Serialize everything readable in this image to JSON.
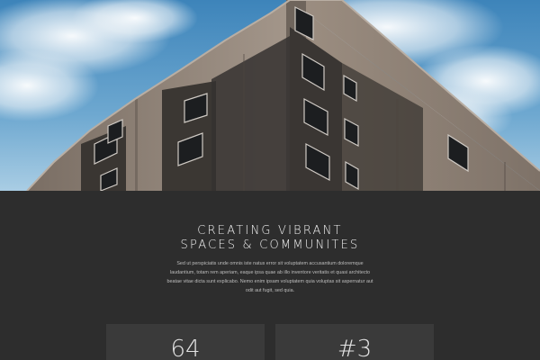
{
  "hero": {
    "image_subject": "building-corner-photo",
    "sky_color": "#5b9bc9",
    "facade_color": "#8d7f73"
  },
  "section": {
    "heading_line1": "CREATING VIBRANT",
    "heading_line2": "SPACES & COMMUNITES",
    "paragraph": "Sed ut perspiciatis unde omnis iste natus error sit voluptatem accusantium doloremque laudantium, totam rem aperiam, eaque ipsa quae ab illo inventore veritatis et quasi architecto beatae vitae dicta sunt explicabo. Nemo enim ipsam voluptatem quia voluptas sit aspernatur aut odit aut fugit, sed quia."
  },
  "stats": [
    {
      "value": "64"
    },
    {
      "value": "#3"
    }
  ],
  "colors": {
    "background": "#2d2d2d",
    "card": "#3a3a3a",
    "heading": "#f1f1f1"
  }
}
